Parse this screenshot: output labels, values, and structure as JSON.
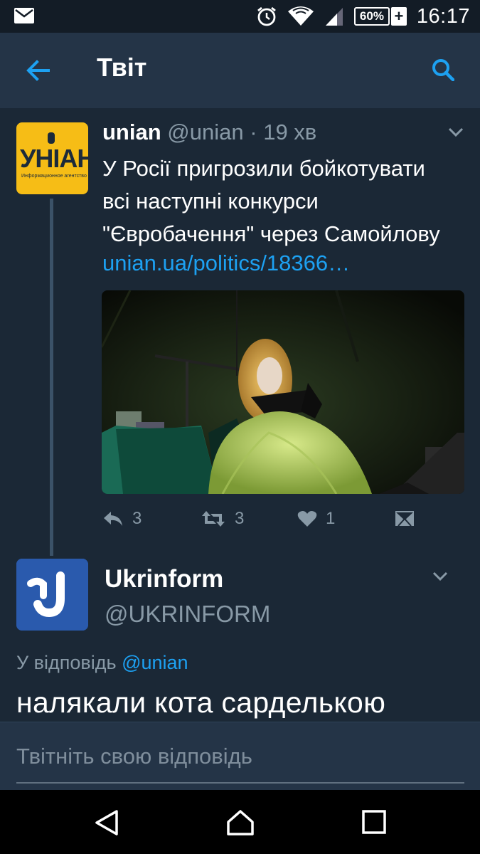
{
  "status_bar": {
    "time": "16:17",
    "battery": "60%",
    "battery_charging": "+"
  },
  "app_bar": {
    "title": "Твіт"
  },
  "tweet1": {
    "avatar_logo": "УНІАН",
    "avatar_sub": "Информационное агентство",
    "name": "unian",
    "handle": "@unian",
    "time": "19 хв",
    "text_lines": [
      "У Росії пригрозили бойкотувати",
      "всі наступні конкурси",
      "\"Євробачення\" через Самойлову"
    ],
    "link": "unian.ua/politics/18366…",
    "reply_count": "3",
    "retweet_count": "3",
    "like_count": "1"
  },
  "tweet2": {
    "name": "Ukrinform",
    "handle": "@UKRINFORM",
    "reply_label": "У відповідь",
    "reply_mention": "@unian",
    "text": "налякали кота сарделькою"
  },
  "reply_box": {
    "placeholder": "Твітніть свою відповідь"
  },
  "colors": {
    "background": "#1b2836",
    "app_bar": "#243447",
    "accent": "#1da1f2",
    "muted": "#8899a6"
  }
}
